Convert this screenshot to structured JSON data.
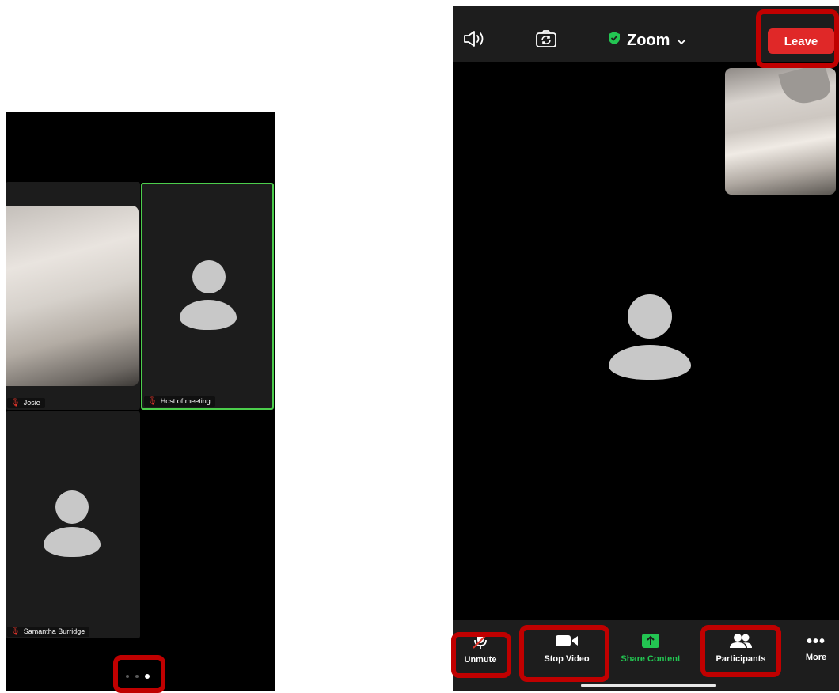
{
  "gallery": {
    "tiles": [
      {
        "name": "Josie",
        "muted": true
      },
      {
        "name": "Host of meeting",
        "muted": true,
        "active_speaker": true
      },
      {
        "name": "Samantha Burridge",
        "muted": true
      }
    ],
    "pages": {
      "count": 3,
      "current": 3
    }
  },
  "meeting": {
    "title": "Zoom",
    "leave_label": "Leave",
    "toolbar": {
      "unmute_label": "Unmute",
      "stop_video_label": "Stop Video",
      "share_label": "Share Content",
      "participants_label": "Participants",
      "more_label": "More"
    }
  },
  "colors": {
    "leave_button": "#e02828",
    "secure_shield": "#23c552",
    "share_content": "#23c552",
    "active_speaker_border": "#4ccd4c",
    "muted_mic": "#e0352b",
    "callout": "#c00000"
  },
  "icons": [
    "speaker-icon",
    "switch-camera-icon",
    "shield-check-icon",
    "chevron-down-icon",
    "mic-muted-icon",
    "video-camera-icon",
    "share-arrow-icon",
    "participants-icon",
    "more-dots-icon"
  ]
}
